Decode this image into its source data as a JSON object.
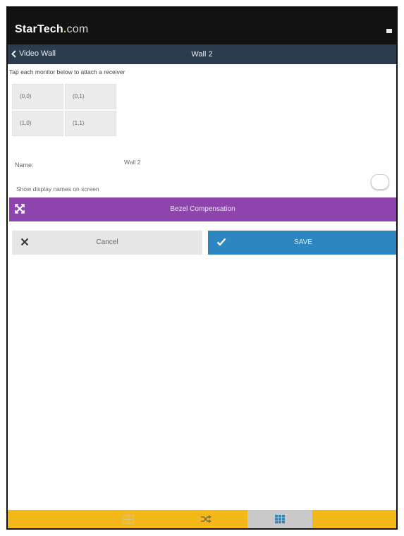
{
  "app": {
    "logo_brand": "StarTech",
    "logo_dot": ".",
    "logo_tld": "com"
  },
  "nav": {
    "back_label": "Video Wall",
    "title": "Wall 2"
  },
  "wall": {
    "instruction": "Tap each monitor below to attach a receiver",
    "cells": [
      "(0,0)",
      "(0,1)",
      "(1,0)",
      "(1,1)"
    ]
  },
  "settings": {
    "name_label": "Name:",
    "name_value": "Wall 2",
    "show_names_label": "Show display names on screen",
    "show_names_enabled": false
  },
  "actions": {
    "bezel_label": "Bezel Compensation",
    "cancel_label": "Cancel",
    "save_label": "SAVE"
  },
  "tabs": [
    {
      "icon": "monitor-grid-icon",
      "active": false
    },
    {
      "icon": "shuffle-icon",
      "active": false
    },
    {
      "icon": "video-wall-grid-icon",
      "active": true
    }
  ],
  "colors": {
    "appbar": "#121212",
    "navbar": "#2b3c4e",
    "bezel": "#8e44ad",
    "save": "#2e86c1",
    "tabbar": "#f4b918",
    "logo_accent": "#f2b400"
  }
}
